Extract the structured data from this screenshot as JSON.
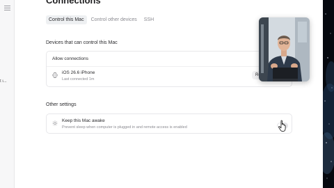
{
  "page": {
    "title": "Connections",
    "tabs": [
      {
        "label": "Control this Mac",
        "active": true
      },
      {
        "label": "Control other devices",
        "active": false
      },
      {
        "label": "SSH",
        "active": false
      }
    ]
  },
  "sidebar": {
    "toggle_icon": "sidebar-toggle-icon",
    "peek_text": "t i..."
  },
  "devices_section": {
    "label": "Devices that can control this Mac",
    "card_title": "Allow connections",
    "devices": [
      {
        "icon": "phone-icon",
        "name": "iOS 26.6 iPhone",
        "last_connected": "Last connected 1m",
        "action": "Rev"
      }
    ]
  },
  "other_section": {
    "label": "Other settings",
    "settings": [
      {
        "icon": "sun-icon",
        "title": "Keep this Mac awake",
        "description": "Prevent sleep when computer is plugged in and remote access is enabled",
        "enabled": false
      }
    ]
  },
  "overlay": {
    "video_icon": "presenter-video-thumbnail"
  },
  "colors": {
    "background": "#ffffff",
    "sidebar": "#f7f7f8",
    "tab_active": "#eef0f2",
    "border": "#e7e7ea",
    "muted_text": "#8a8a90"
  }
}
